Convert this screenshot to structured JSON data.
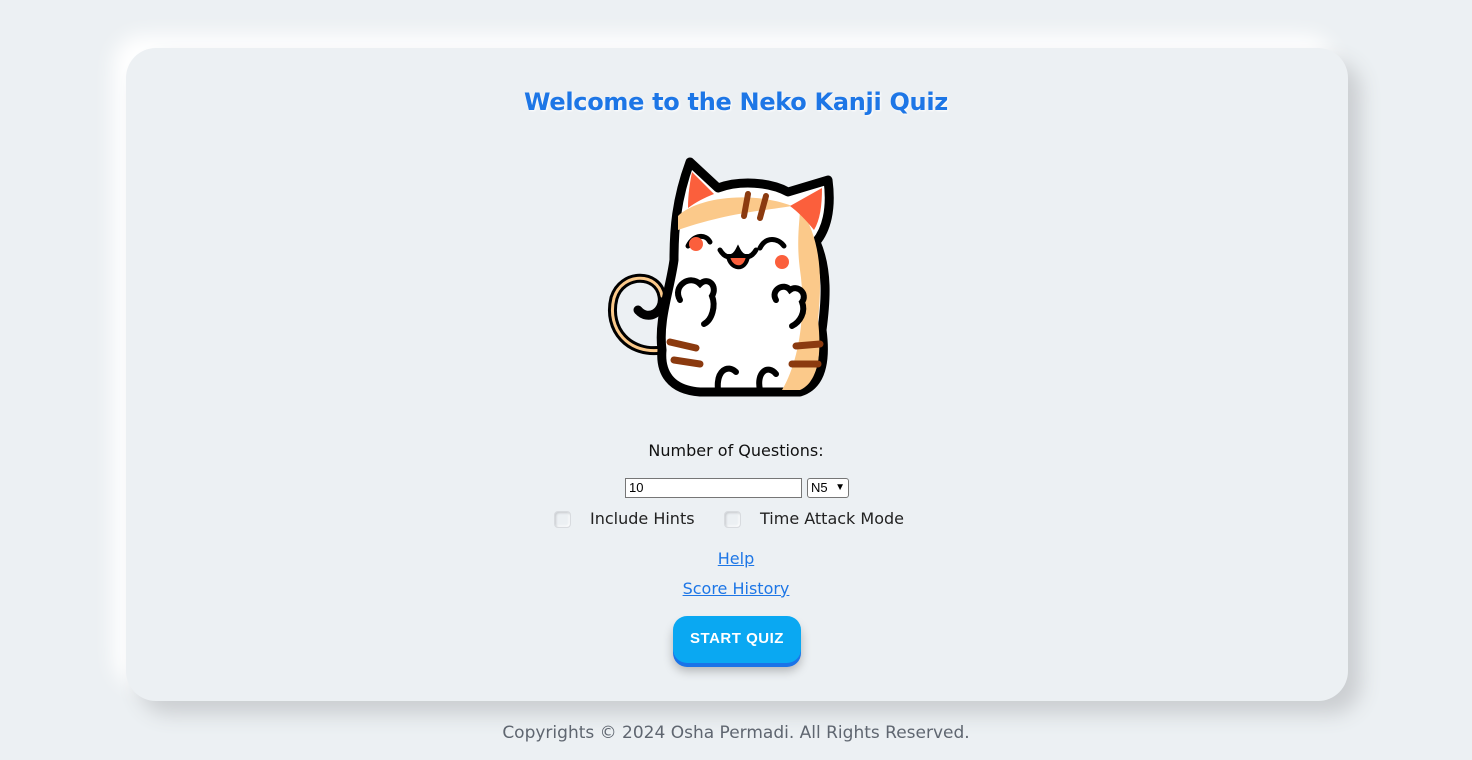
{
  "title": "Welcome to the Neko Kanji Quiz",
  "mascot": {
    "icon": "cat-mascot-icon"
  },
  "form": {
    "questions_label": "Number of Questions:",
    "questions_value": "10",
    "level_value": "N5",
    "include_hints_label": "Include Hints",
    "include_hints_checked": false,
    "time_attack_label": "Time Attack Mode",
    "time_attack_checked": false
  },
  "links": {
    "help": "Help",
    "score_history": "Score History"
  },
  "start_button": "START QUIZ",
  "footer": "Copyrights © 2024 Osha Permadi. All Rights Reserved.",
  "colors": {
    "background": "#ecf0f3",
    "title": "#1d76e6",
    "button": "#0aa8f2",
    "link": "#1d76e6"
  }
}
